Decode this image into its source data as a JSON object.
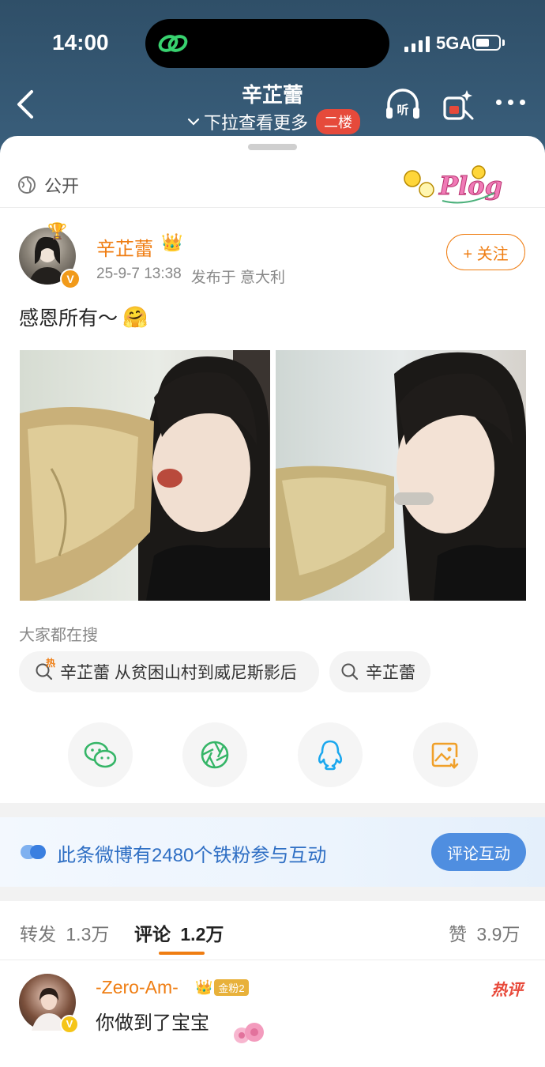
{
  "status_bar": {
    "time": "14:00",
    "network": "5GA"
  },
  "nav": {
    "title": "辛芷蕾",
    "subtitle": "下拉查看更多",
    "floor_badge": "二楼",
    "listen_label": "听"
  },
  "visibility": "公开",
  "post": {
    "username": "辛芷蕾",
    "date": "25-9-7 13:38",
    "location": "发布于 意大利",
    "follow_label": "+ 关注",
    "text": "感恩所有～"
  },
  "search": {
    "label": "大家都在搜",
    "hot_tag": "热",
    "items": [
      "辛芷蕾 从贫困山村到威尼斯影后",
      "辛芷蕾"
    ]
  },
  "fan_banner": {
    "text": "此条微博有2480个铁粉参与互动",
    "button": "评论互动"
  },
  "tabs": {
    "repost_label": "转发",
    "repost_count": "1.3万",
    "comment_label": "评论",
    "comment_count": "1.2万",
    "like_label": "赞",
    "like_count": "3.9万"
  },
  "comment": {
    "username": "-Zero-Am-",
    "badge": "金粉2",
    "text": "你做到了宝宝",
    "hot_label": "热评"
  },
  "colors": {
    "accent": "#ef7d12",
    "header": "#3a5f7c",
    "link_blue": "#2f6fc4",
    "hot_red": "#e8493a"
  }
}
